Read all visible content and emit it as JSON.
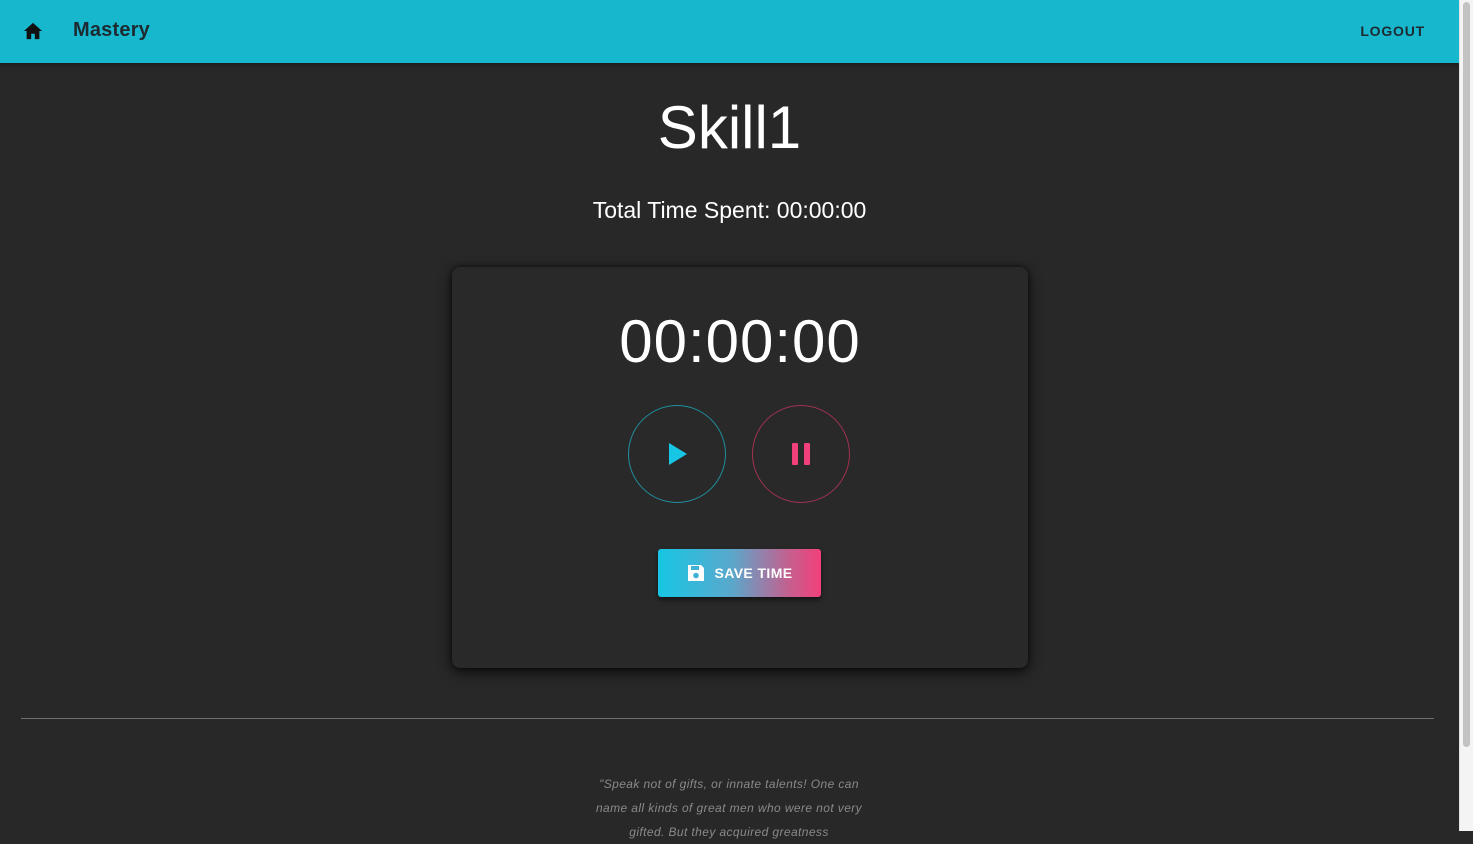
{
  "appbar": {
    "brand": "Mastery",
    "logout_label": "LOGOUT",
    "home_icon": "home-icon",
    "color": "#17b7ce"
  },
  "skill": {
    "title": "Skill1",
    "total_time": "Total Time Spent: 00:00:00"
  },
  "timer": {
    "display": "00:00:00",
    "play_icon": "play-icon",
    "pause_icon": "pause-icon",
    "save_label": "SAVE TIME",
    "save_icon": "save-icon",
    "play_color": "#17c6e4",
    "pause_color": "#f2407a"
  },
  "footer": {
    "quote": "\"Speak not of gifts, or innate talents! One can name all kinds of great men who were not very gifted. But they acquired greatness"
  }
}
